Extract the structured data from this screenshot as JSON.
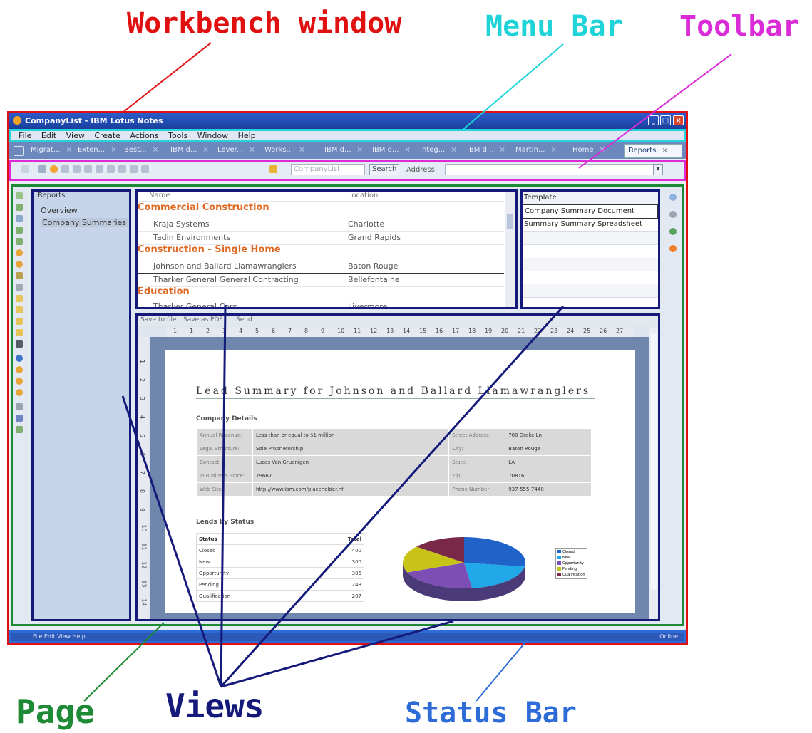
{
  "annotations": {
    "workbench_window": "Workbench window",
    "menu_bar": "Menu Bar",
    "toolbar": "Toolbar",
    "page": "Page",
    "views": "Views",
    "status_bar": "Status Bar"
  },
  "colors": {
    "workbench": "#e01010",
    "menu_bar": "#26d3d8",
    "toolbar": "#de2bd8",
    "page": "#1e8a35",
    "views": "#151a7a",
    "status_bar": "#2d6cd7",
    "category": "#e06820"
  },
  "window": {
    "title": "CompanyList - IBM Lotus Notes",
    "controls": [
      "_",
      "□",
      "×"
    ]
  },
  "menu": [
    "File",
    "Edit",
    "View",
    "Create",
    "Actions",
    "Tools",
    "Window",
    "Help"
  ],
  "tabs": [
    {
      "label": "Migrat..."
    },
    {
      "label": "Exten..."
    },
    {
      "label": "Best..."
    },
    {
      "label": "IBM d..."
    },
    {
      "label": "Lever..."
    },
    {
      "label": "Works..."
    },
    {
      "label": "IBM d..."
    },
    {
      "label": "IBM d..."
    },
    {
      "label": "Integ..."
    },
    {
      "label": "IBM d..."
    },
    {
      "label": "Martin..."
    },
    {
      "label": "Home"
    },
    {
      "label": "Reports"
    }
  ],
  "toolbar": {
    "search_placeholder": "CompanyList",
    "search_button": "Search",
    "address_label": "Address:"
  },
  "navigator": {
    "title": "Reports",
    "items": [
      "Overview",
      "Company Summaries"
    ]
  },
  "list_view": {
    "columns": [
      "Name",
      "Location"
    ],
    "groups": [
      {
        "category": "Commercial Construction",
        "rows": [
          {
            "name": "Kraja Systems",
            "location": "Charlotte"
          },
          {
            "name": "Tadin Environments",
            "location": "Grand Rapids"
          }
        ]
      },
      {
        "category": "Construction - Single Home",
        "rows": [
          {
            "name": "Johnson and Ballard Llamawranglers",
            "location": "Baton Rouge"
          },
          {
            "name": "Tharker General General Contracting",
            "location": "Bellefontaine"
          }
        ]
      },
      {
        "category": "Education",
        "rows": [
          {
            "name": "Tharker General Corp",
            "location": "Livermore"
          }
        ]
      }
    ]
  },
  "template_view": {
    "header": "Template",
    "items": [
      "Company Summary Document",
      "Summary Summary Spreadsheet"
    ]
  },
  "document": {
    "actions": [
      "Save to file",
      "Save as PDF",
      "Send"
    ],
    "ruler_marks": [
      "1",
      "1",
      "2",
      "3",
      "4",
      "5",
      "6",
      "7",
      "8",
      "9",
      "10",
      "11",
      "12",
      "13",
      "14",
      "15",
      "16",
      "17",
      "18",
      "19",
      "20",
      "21",
      "22",
      "23",
      "24",
      "25",
      "26",
      "27"
    ],
    "vertical_marks": [
      "1",
      "2",
      "3",
      "4",
      "5",
      "6",
      "7",
      "8",
      "9",
      "10",
      "11",
      "12",
      "13",
      "14"
    ],
    "title": "Lead Summary for Johnson and Ballard Llamawranglers",
    "company_details_heading": "Company Details",
    "details": [
      [
        "Annual Revenue:",
        "Less than or equal to $1 million",
        "Street Address:",
        "700 Drake Ln"
      ],
      [
        "Legal Structure:",
        "Sole Proprietorship",
        "City:",
        "Baton Rouge"
      ],
      [
        "Contact:",
        "Lucas Van Gruenigen",
        "State:",
        "LA"
      ],
      [
        "In Business Since:",
        "79667",
        "Zip:",
        "70816"
      ],
      [
        "Web Site:",
        "http://www.ibm.com/placeholder.nfl",
        "Phone Number:",
        "937-555-7440"
      ]
    ],
    "leads_heading": "Leads by Status",
    "status_header": [
      "Status",
      "Total"
    ],
    "status_rows": [
      [
        "Closed",
        "400"
      ],
      [
        "New",
        "300"
      ],
      [
        "Opportunity",
        "306"
      ],
      [
        "Pending",
        "248"
      ],
      [
        "Qualification",
        "207"
      ]
    ],
    "legend": [
      "Closed",
      "New",
      "Opportunity",
      "Pending",
      "Qualification"
    ]
  },
  "chart_data": {
    "type": "pie",
    "categories": [
      "Closed",
      "New",
      "Opportunity",
      "Pending",
      "Qualification"
    ],
    "values": [
      400,
      300,
      306,
      248,
      207
    ],
    "colors": [
      "#1f63c9",
      "#21a8e8",
      "#7d4fb5",
      "#c8c417",
      "#7a2848"
    ],
    "legend_position": "right"
  },
  "status_bar": {
    "left": "File Edit View Help",
    "right": "Online"
  }
}
